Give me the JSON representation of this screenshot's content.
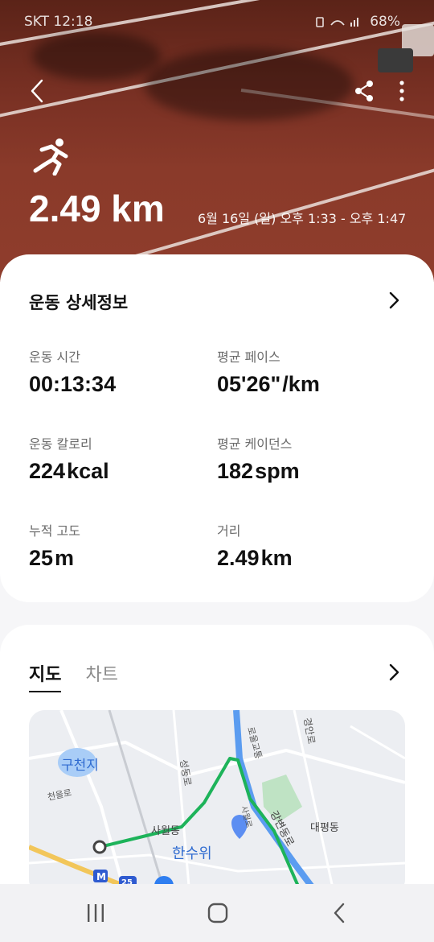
{
  "status_bar": {
    "carrier_time": "SKT 12:18",
    "battery": "68%"
  },
  "header": {
    "activity_icon": "running-icon",
    "distance_label": "2.49 km",
    "datetime_label": "6월 16일 (일) 오후 1:33 - 오후 1:47"
  },
  "details": {
    "title": "운동 상세정보",
    "stats": [
      {
        "label": "운동 시간",
        "value": "00:13:34",
        "unit": ""
      },
      {
        "label": "평균 페이스",
        "value": "05'26\"",
        "unit": "/km"
      },
      {
        "label": "운동 칼로리",
        "value": "224",
        "unit": "kcal"
      },
      {
        "label": "평균 케이던스",
        "value": "182",
        "unit": "spm"
      },
      {
        "label": "누적 고도",
        "value": "25",
        "unit": "m"
      },
      {
        "label": "거리",
        "value": "2.49",
        "unit": "km"
      }
    ]
  },
  "map_section": {
    "tabs": [
      {
        "label": "지도",
        "active": true
      },
      {
        "label": "차트",
        "active": false
      }
    ],
    "labels": {
      "lake": "구천지",
      "district1": "사월동",
      "district2": "대평동",
      "poi": "한수위",
      "road1": "성동로",
      "road2": "천을로",
      "road3": "강변동로",
      "road4": "경안로",
      "road5": "로울교통",
      "road6": "사월로",
      "metro": "M",
      "route_num": "25"
    },
    "colors": {
      "route": "#1db35a",
      "river": "#5b9cf0",
      "park": "#bfe3c4"
    }
  },
  "colors": {
    "accent": "#111111",
    "hero_track": "#8a3a2a"
  }
}
